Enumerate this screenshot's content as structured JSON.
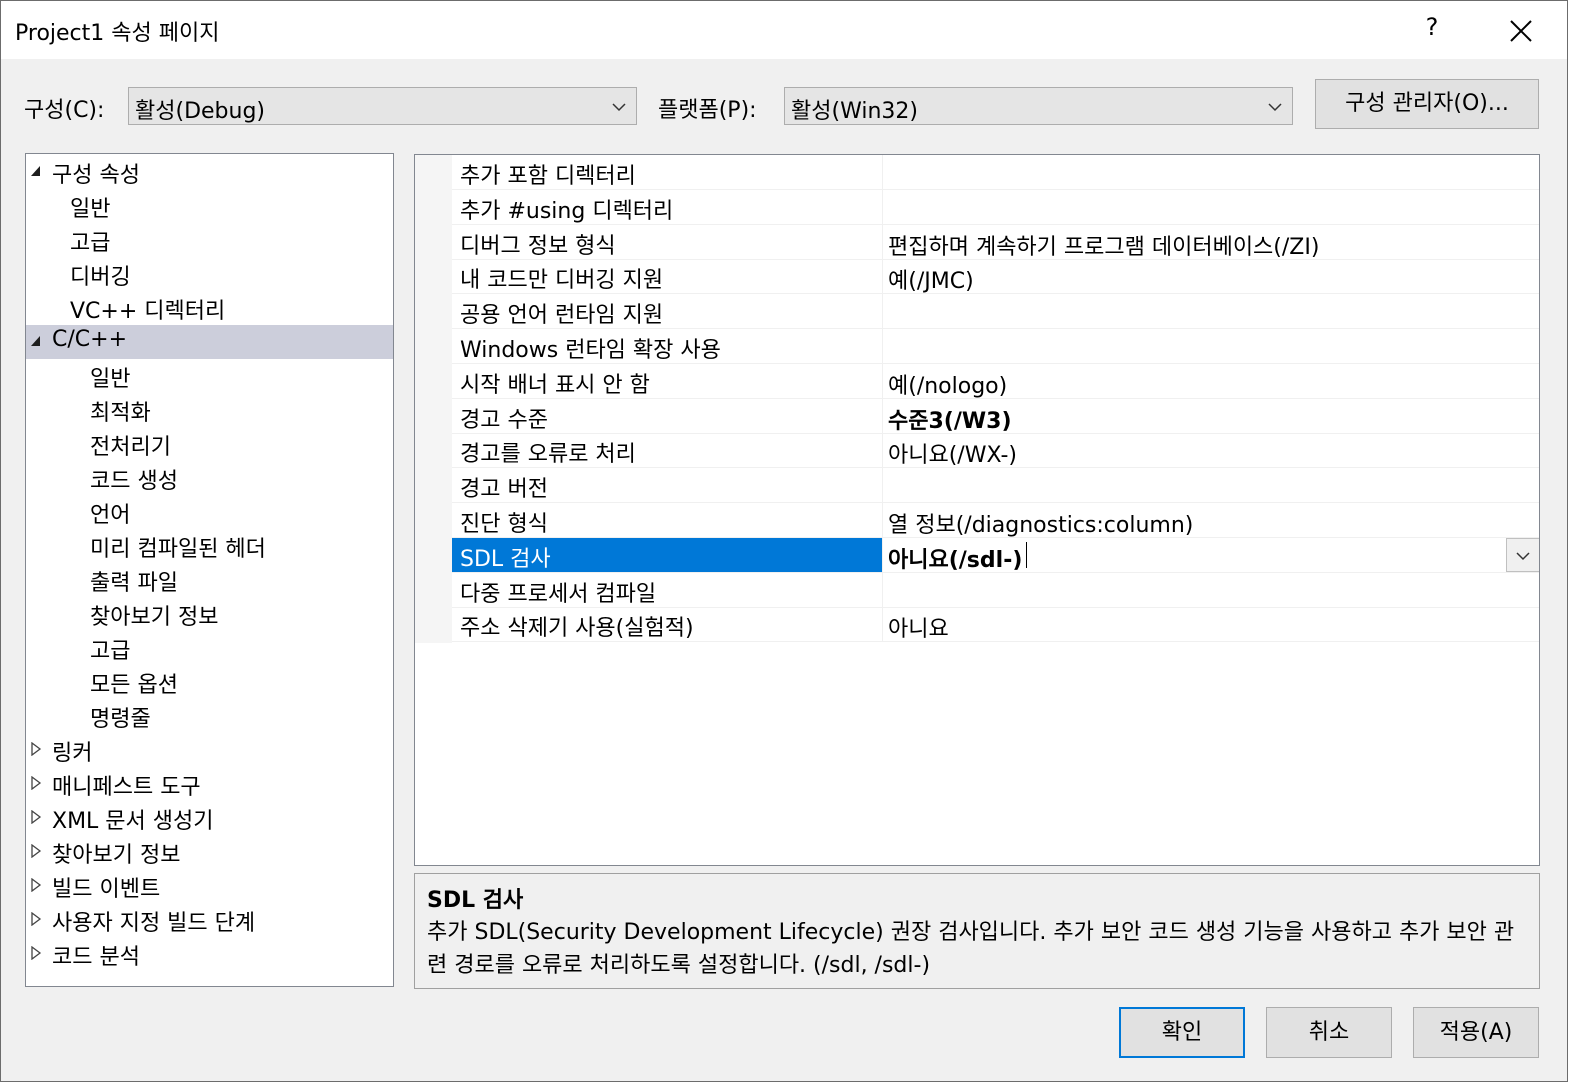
{
  "window": {
    "title": "Project1 속성 페이지",
    "help": "?",
    "close_icon": "close-icon"
  },
  "toolbar": {
    "config_label": "구성(C):",
    "config_value": "활성(Debug)",
    "platform_label": "플랫폼(P):",
    "platform_value": "활성(Win32)",
    "config_manager": "구성 관리자(O)..."
  },
  "tree": {
    "items": [
      {
        "label": "구성 속성",
        "expander": "expanded"
      },
      {
        "label": "일반"
      },
      {
        "label": "고급"
      },
      {
        "label": "디버깅"
      },
      {
        "label": "VC++ 디렉터리"
      },
      {
        "label": "C/C++",
        "expander": "expanded",
        "selected": true
      },
      {
        "label": "일반"
      },
      {
        "label": "최적화"
      },
      {
        "label": "전처리기"
      },
      {
        "label": "코드 생성"
      },
      {
        "label": "언어"
      },
      {
        "label": "미리 컴파일된 헤더"
      },
      {
        "label": "출력 파일"
      },
      {
        "label": "찾아보기 정보"
      },
      {
        "label": "고급"
      },
      {
        "label": "모든 옵션"
      },
      {
        "label": "명령줄"
      },
      {
        "label": "링커",
        "expander": "collapsed"
      },
      {
        "label": "매니페스트 도구",
        "expander": "collapsed"
      },
      {
        "label": "XML 문서 생성기",
        "expander": "collapsed"
      },
      {
        "label": "찾아보기 정보",
        "expander": "collapsed"
      },
      {
        "label": "빌드 이벤트",
        "expander": "collapsed"
      },
      {
        "label": "사용자 지정 빌드 단계",
        "expander": "collapsed"
      },
      {
        "label": "코드 분석",
        "expander": "collapsed"
      }
    ]
  },
  "properties": [
    {
      "name": "추가 포함 디렉터리",
      "value": ""
    },
    {
      "name": "추가 #using 디렉터리",
      "value": ""
    },
    {
      "name": "디버그 정보 형식",
      "value": "편집하며 계속하기 프로그램 데이터베이스(/ZI)"
    },
    {
      "name": "내 코드만 디버깅 지원",
      "value": "예(/JMC)"
    },
    {
      "name": "공용 언어 런타임 지원",
      "value": ""
    },
    {
      "name": "Windows 런타임 확장 사용",
      "value": ""
    },
    {
      "name": "시작 배너 표시 안 함",
      "value": "예(/nologo)"
    },
    {
      "name": "경고 수준",
      "value": "수준3(/W3)",
      "bold": true
    },
    {
      "name": "경고를 오류로 처리",
      "value": "아니요(/WX-)"
    },
    {
      "name": "경고 버전",
      "value": ""
    },
    {
      "name": "진단 형식",
      "value": "열 정보(/diagnostics:column)"
    },
    {
      "name": "SDL 검사",
      "value": "아니요(/sdl-)",
      "bold": true,
      "selected": true
    },
    {
      "name": "다중 프로세서 컴파일",
      "value": ""
    },
    {
      "name": "주소 삭제기 사용(실험적)",
      "value": "아니요"
    }
  ],
  "description": {
    "title": "SDL 검사",
    "body": "추가 SDL(Security Development Lifecycle) 권장 검사입니다. 추가 보안 코드 생성 기능을 사용하고 추가 보안 관련 경로를 오류로 처리하도록 설정합니다. (/sdl, /sdl-)"
  },
  "buttons": {
    "ok": "확인",
    "cancel": "취소",
    "apply": "적용(A)"
  },
  "colors": {
    "accent": "#0078d7",
    "tree_selected": "#cccedb",
    "dialog_bg": "#f0f0f0"
  }
}
